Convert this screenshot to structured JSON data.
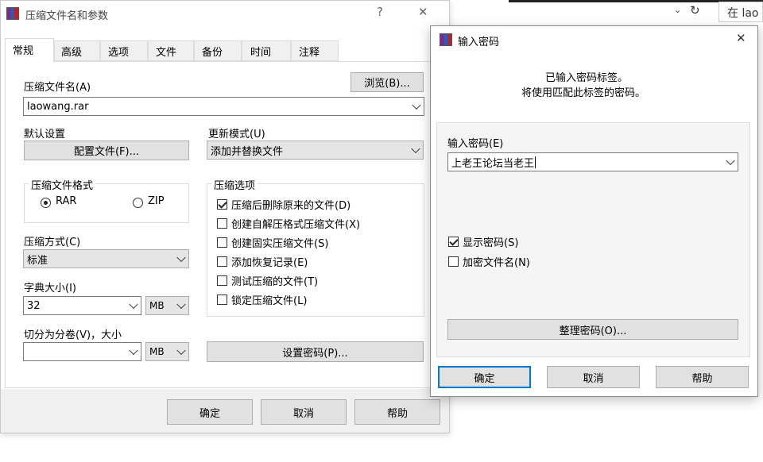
{
  "background": {
    "address_text": "在 lao"
  },
  "main_dialog": {
    "title": "压缩文件名和参数",
    "help_glyph": "?",
    "close_glyph": "✕",
    "tabs": [
      "常规",
      "高级",
      "选项",
      "文件",
      "备份",
      "时间",
      "注释"
    ],
    "archive_name_label": "压缩文件名(A)",
    "browse_button": "浏览(B)...",
    "archive_name_value": "laowang.rar",
    "default_settings_label": "默认设置",
    "profiles_button": "配置文件(F)...",
    "update_mode_label": "更新模式(U)",
    "update_mode_value": "添加并替换文件",
    "format_group_title": "压缩文件格式",
    "format_rar": "RAR",
    "format_zip": "ZIP",
    "compression_method_label": "压缩方式(C)",
    "compression_method_value": "标准",
    "dictionary_label": "字典大小(I)",
    "dictionary_value": "32",
    "dictionary_unit": "MB",
    "split_label": "切分为分卷(V)，大小",
    "split_value": "",
    "split_unit": "MB",
    "options_group_title": "压缩选项",
    "options": [
      {
        "label": "压缩后删除原来的文件(D)",
        "checked": true
      },
      {
        "label": "创建自解压格式压缩文件(X)",
        "checked": false
      },
      {
        "label": "创建固实压缩文件(S)",
        "checked": false
      },
      {
        "label": "添加恢复记录(E)",
        "checked": false
      },
      {
        "label": "测试压缩的文件(T)",
        "checked": false
      },
      {
        "label": "锁定压缩文件(L)",
        "checked": false
      }
    ],
    "set_password_button": "设置密码(P)...",
    "ok_button": "确定",
    "cancel_button": "取消",
    "help_button": "帮助"
  },
  "password_dialog": {
    "title": "输入密码",
    "close_glyph": "✕",
    "info_line1": "已输入密码标签。",
    "info_line2": "将使用匹配此标签的密码。",
    "password_label": "输入密码(E)",
    "password_value": "上老王论坛当老王",
    "show_password_label": "显示密码(S)",
    "show_password_checked": true,
    "encrypt_names_label": "加密文件名(N)",
    "encrypt_names_checked": false,
    "organize_button": "整理密码(O)...",
    "ok_button": "确定",
    "cancel_button": "取消",
    "help_button": "帮助"
  },
  "colors": {
    "accent": "#0078d7",
    "button_face": "#e1e1e1",
    "button_border": "#adadad",
    "panel": "#f0f0f0"
  }
}
